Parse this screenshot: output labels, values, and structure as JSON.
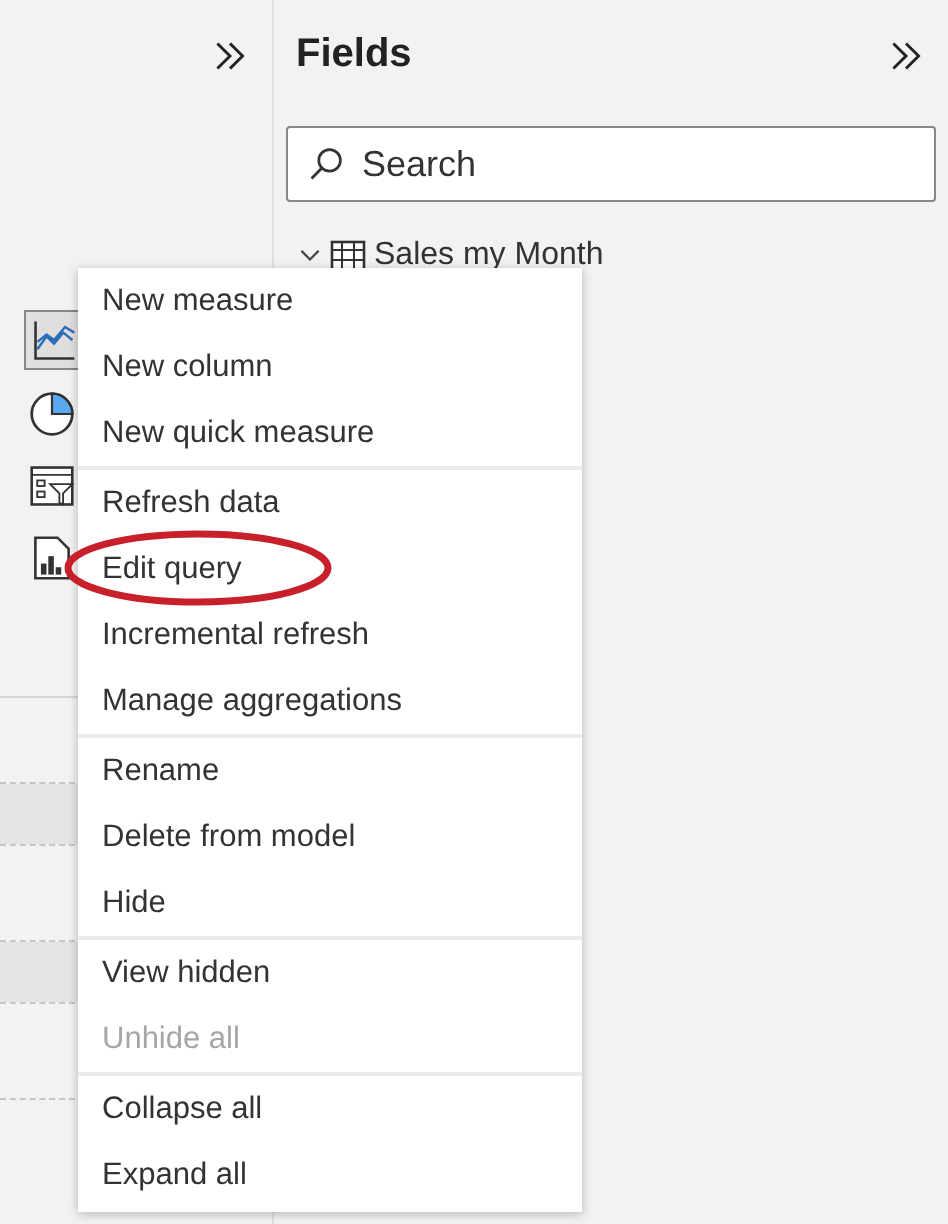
{
  "visualizations_pane": {
    "visuals": [
      {
        "kind": "line-chart",
        "selected": true
      },
      {
        "kind": "pie-chart",
        "selected": false
      },
      {
        "kind": "slicer",
        "selected": false
      },
      {
        "kind": "report",
        "selected": false
      }
    ]
  },
  "fields_pane": {
    "title": "Fields",
    "search": {
      "placeholder": "Search"
    },
    "tables": [
      {
        "name": "Sales my Month",
        "expanded": true
      }
    ]
  },
  "context_menu": {
    "groups": [
      [
        {
          "label": "New measure",
          "disabled": false,
          "circled": false
        },
        {
          "label": "New column",
          "disabled": false,
          "circled": false
        },
        {
          "label": "New quick measure",
          "disabled": false,
          "circled": false
        }
      ],
      [
        {
          "label": "Refresh data",
          "disabled": false,
          "circled": false
        },
        {
          "label": "Edit query",
          "disabled": false,
          "circled": true
        },
        {
          "label": "Incremental refresh",
          "disabled": false,
          "circled": false
        },
        {
          "label": "Manage aggregations",
          "disabled": false,
          "circled": false
        }
      ],
      [
        {
          "label": "Rename",
          "disabled": false,
          "circled": false
        },
        {
          "label": "Delete from model",
          "disabled": false,
          "circled": false
        },
        {
          "label": "Hide",
          "disabled": false,
          "circled": false
        }
      ],
      [
        {
          "label": "View hidden",
          "disabled": false,
          "circled": false
        },
        {
          "label": "Unhide all",
          "disabled": true,
          "circled": false
        }
      ],
      [
        {
          "label": "Collapse all",
          "disabled": false,
          "circled": false
        },
        {
          "label": "Expand all",
          "disabled": false,
          "circled": false
        }
      ]
    ]
  }
}
